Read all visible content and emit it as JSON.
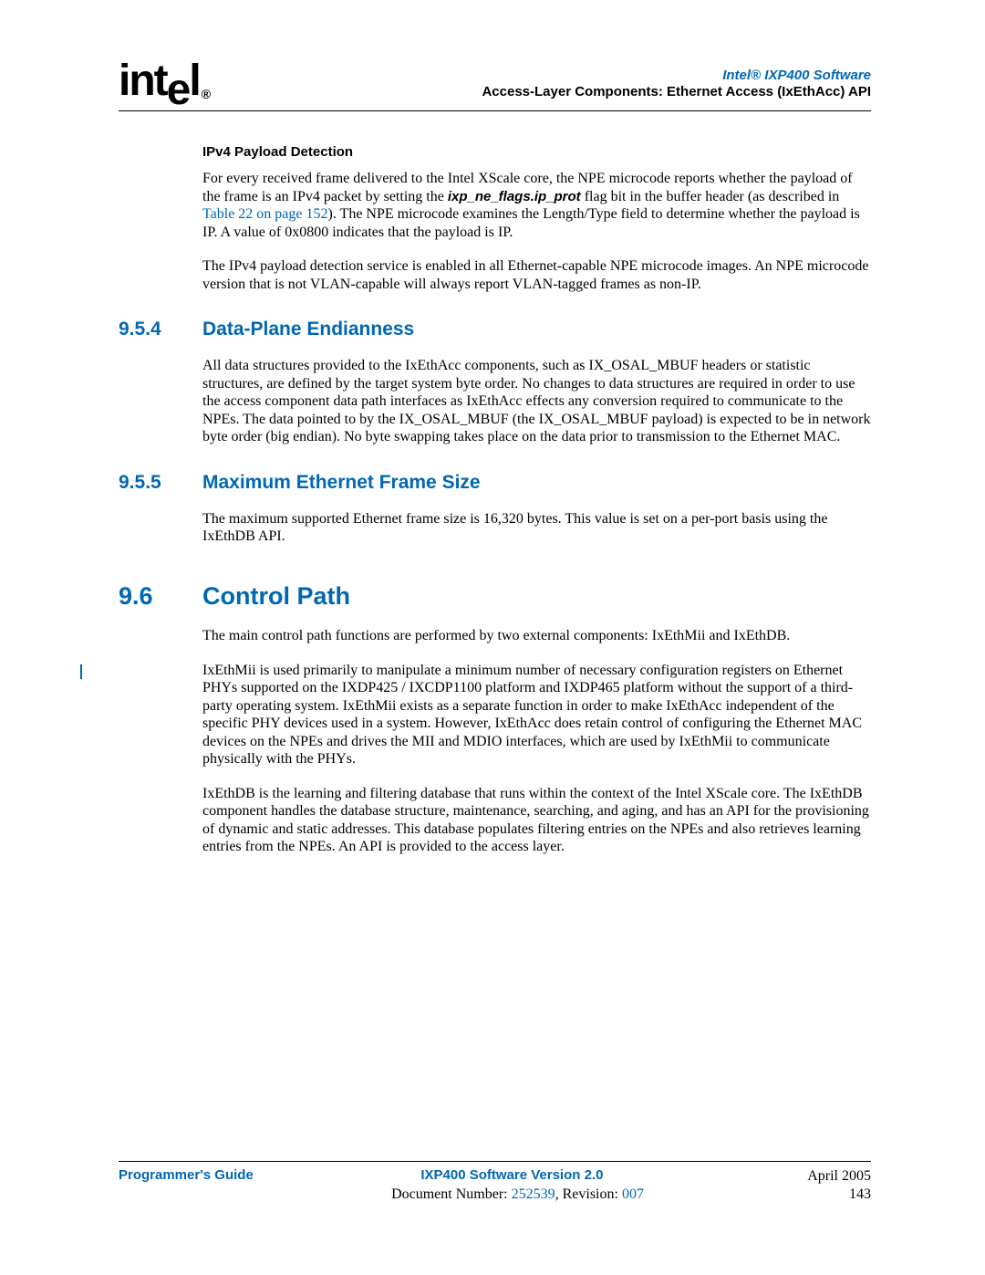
{
  "header": {
    "product_line": "Intel® IXP400 Software",
    "chapter_line": "Access-Layer Components: Ethernet Access (IxEthAcc) API"
  },
  "ipv4_payload": {
    "heading": "IPv4 Payload Detection",
    "p1_a": "For every received frame delivered to the Intel XScale core, the NPE microcode reports whether the payload of the frame is an IPv4 packet by setting the ",
    "flag": "ixp_ne_flags.ip_prot",
    "p1_b": " flag bit in the buffer header (as described in ",
    "xref": "Table 22 on page 152",
    "p1_c": "). The NPE microcode examines the Length/Type field to determine whether the payload is IP. A value of 0x0800 indicates that the payload is IP.",
    "p2": "The IPv4 payload detection service is enabled in all Ethernet-capable NPE microcode images. An NPE microcode version that is not VLAN-capable will always report VLAN-tagged frames as non-IP."
  },
  "sec954": {
    "num": "9.5.4",
    "title": "Data-Plane Endianness",
    "p1": "All data structures provided to the IxEthAcc components, such as IX_OSAL_MBUF headers or statistic structures, are defined by the target system byte order. No changes to data structures are required in order to use the access component data path interfaces as IxEthAcc effects any conversion required to communicate to the NPEs. The data pointed to by the IX_OSAL_MBUF (the IX_OSAL_MBUF payload) is expected to be in network byte order (big endian). No byte swapping takes place on the data prior to transmission to the Ethernet MAC."
  },
  "sec955": {
    "num": "9.5.5",
    "title": "Maximum Ethernet Frame Size",
    "p1": "The maximum supported Ethernet frame size is 16,320 bytes. This value is set on a per-port basis using the IxEthDB API."
  },
  "sec96": {
    "num": "9.6",
    "title": "Control Path",
    "p1": "The main control path functions are performed by two external components: IxEthMii and IxEthDB.",
    "p2": "IxEthMii is used primarily to manipulate a minimum number of necessary configuration registers on Ethernet PHYs supported on the IXDP425 / IXCDP1100 platform and IXDP465 platform without the support of a third-party operating system. IxEthMii exists as a separate function in order to make IxEthAcc independent of the specific PHY devices used in a system. However, IxEthAcc does retain control of configuring the Ethernet MAC devices on the NPEs and drives the MII and MDIO interfaces, which are used by IxEthMii to communicate physically with the PHYs.",
    "p3": "IxEthDB is the learning and filtering database that runs within the context of the Intel XScale core. The IxEthDB component handles the database structure, maintenance, searching, and aging, and has an API for the provisioning of dynamic and static addresses. This database populates filtering entries on the NPEs and also retrieves learning entries from the NPEs. An API is provided to the access layer."
  },
  "footer": {
    "guide": "Programmer's Guide",
    "version": "IXP400 Software Version 2.0",
    "date": "April 2005",
    "docnum_label": "Document Number: ",
    "docnum": "252539",
    "rev_label": ", Revision: ",
    "rev": "007",
    "page": "143"
  }
}
